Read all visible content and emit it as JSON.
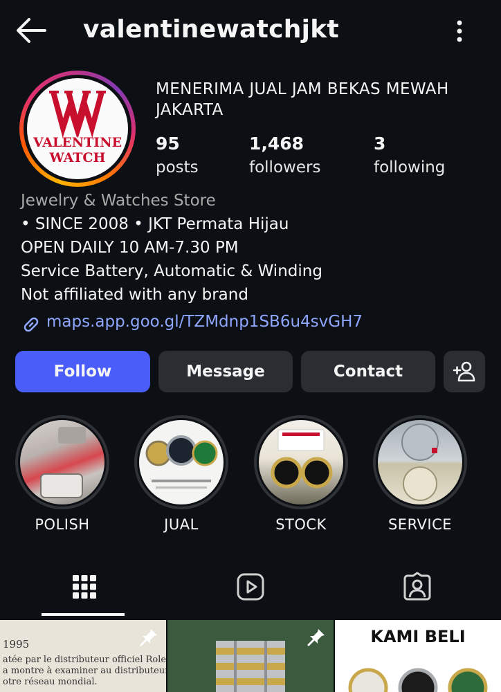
{
  "header": {
    "username": "valentinewatchjkt",
    "back_icon": "arrow-left-icon",
    "more_icon": "more-vertical-icon"
  },
  "profile": {
    "avatar_logo_line1": "VALENTINE",
    "avatar_logo_line2": "WATCH",
    "full_name": "MENERIMA JUAL JAM BEKAS MEWAH JAKARTA",
    "stats": {
      "posts": {
        "count": "95",
        "label": "posts"
      },
      "followers": {
        "count": "1,468",
        "label": "followers"
      },
      "following": {
        "count": "3",
        "label": "following"
      }
    },
    "category": "Jewelry & Watches Store",
    "bio": [
      "• SINCE 2008 • JKT Permata Hijau",
      "OPEN DAILY 10 AM-7.30 PM",
      "Service Battery, Automatic & Winding",
      "Not affiliated with any brand"
    ],
    "link": "maps.app.goo.gl/TZMdnp1SB6u4svGH7"
  },
  "actions": {
    "follow": "Follow",
    "message": "Message",
    "contact": "Contact",
    "add_user_icon": "add-person-icon"
  },
  "highlights": [
    {
      "label": "POLISH"
    },
    {
      "label": "JUAL"
    },
    {
      "label": "STOCK"
    },
    {
      "label": "SERVICE"
    }
  ],
  "tabs": [
    {
      "icon": "grid-icon",
      "active": true
    },
    {
      "icon": "reels-icon",
      "active": false
    },
    {
      "icon": "tagged-icon",
      "active": false
    }
  ],
  "posts": {
    "post1_lines": [
      "1995",
      "atée par le distributeur officiel Rolex au",
      "a montre à examiner au distributeur qui l'a",
      "otre réseau mondial."
    ],
    "post3_text": "KAMI BELI"
  },
  "colors": {
    "background": "#0c1014",
    "follow_button": "#4a5df9",
    "link": "#8fa6ff",
    "secondary_text": "#a8a8a8"
  }
}
